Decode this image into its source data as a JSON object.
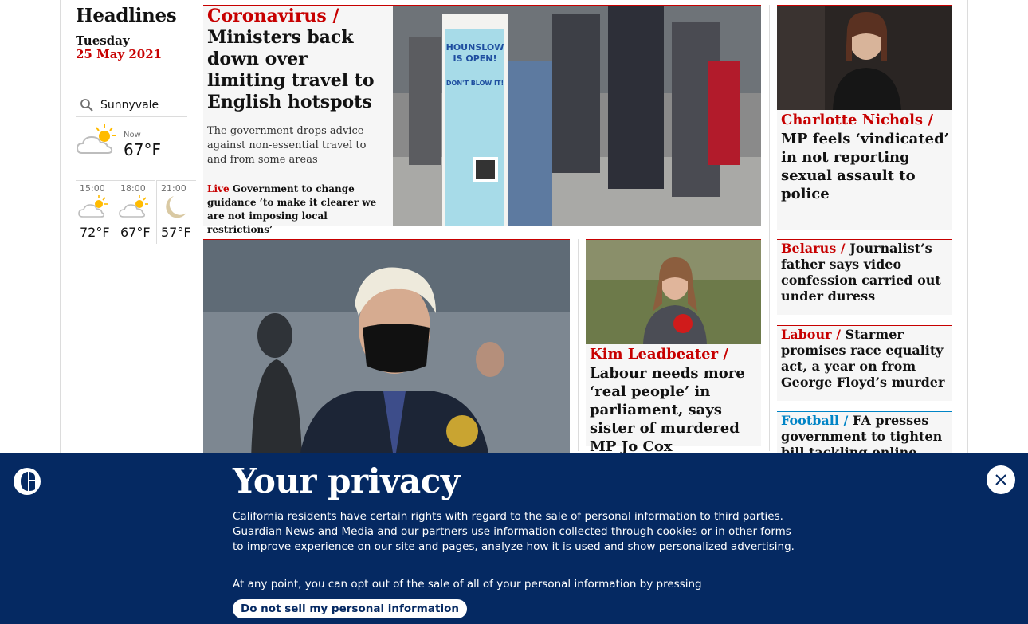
{
  "rail": {
    "title": "Headlines",
    "day": "Tuesday",
    "date": "25 May 2021"
  },
  "weather": {
    "location": "Sunnyvale",
    "now_label": "Now",
    "now_temp": "67°F",
    "now_icon": "partly-cloudy-icon",
    "forecast": [
      {
        "time": "15:00",
        "temp": "72°F",
        "icon": "partly-sunny-icon"
      },
      {
        "time": "18:00",
        "temp": "67°F",
        "icon": "partly-sunny-icon"
      },
      {
        "time": "21:00",
        "temp": "57°F",
        "icon": "moon-icon"
      }
    ]
  },
  "lead": {
    "kicker": "Coronavirus /",
    "headline": "Ministers back down over limiting travel to English hotspots",
    "standfirst": "The government drops advice against non-essential travel to and from some areas",
    "live_label": "Live",
    "live_text": "Government to change guidance ‘to make it clearer we are not imposing local restrictions’",
    "image_sign_line1": "HOUNSLOW",
    "image_sign_line2": "IS OPEN!",
    "image_sign_line3": "DON'T BLOW IT!"
  },
  "right_top": {
    "kicker": "Charlotte Nichols /",
    "headline": "MP feels ‘vindicated’ in not reporting sexual assault to police"
  },
  "kim": {
    "kicker": "Kim Leadbeater /",
    "headline": "Labour needs more ‘real people’ in parliament, says sister of murdered MP Jo Cox"
  },
  "side_stories": [
    {
      "kicker": "Belarus /",
      "headline": "Journalist’s father says video confession carried out under duress"
    },
    {
      "kicker": "Labour /",
      "headline": "Starmer promises race equality act, a year on from George Floyd’s murder"
    },
    {
      "kicker": "Football /",
      "headline": "FA presses government to tighten bill tackling online abuse"
    }
  ],
  "privacy": {
    "title": "Your privacy",
    "body": "California residents have certain rights with regard to the sale of personal information to third parties. Guardian News and Media and our partners use information collected through cookies or in other forms to improve experience on our site and pages, analyze how it is used and show personalized advertising.",
    "optout_text": "At any point, you can opt out of the sale of all of your personal information by pressing",
    "button_label": "Do not sell my personal information",
    "close_icon": "close-icon"
  },
  "colors": {
    "news_red": "#c70000",
    "football_blue": "#0084c6",
    "banner_navy": "#052962",
    "card_grey": "#f6f6f6"
  }
}
